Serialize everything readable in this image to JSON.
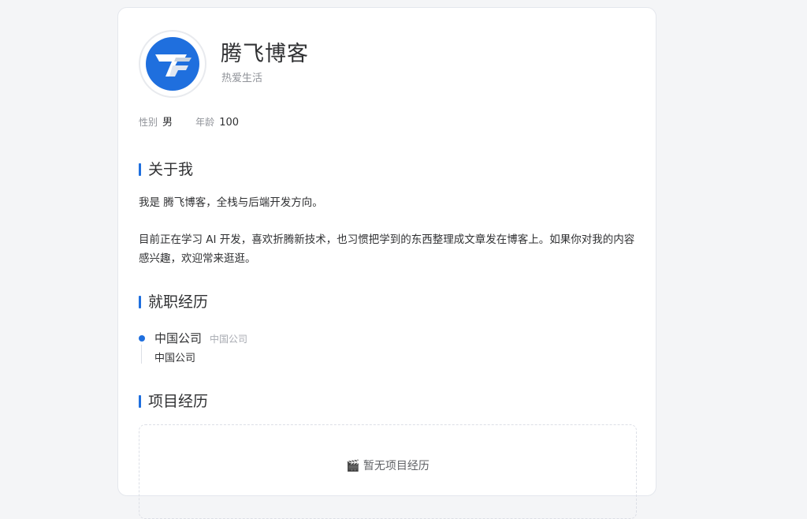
{
  "profile": {
    "name": "腾飞博客",
    "motto": "热爱生活",
    "avatar_icon": "tf-logo-icon",
    "brand_color": "#1f6fde"
  },
  "info": {
    "gender_label": "性别",
    "gender_value": "男",
    "age_label": "年龄",
    "age_value": "100"
  },
  "about": {
    "title": "关于我",
    "line1": "我是 腾飞博客，全栈与后端开发方向。",
    "line2": "目前正在学习 AI 开发，喜欢折腾新技术，也习惯把学到的东西整理成文章发在博客上。如果你对我的内容感兴趣，欢迎常来逛逛。"
  },
  "career": {
    "title": "就职经历",
    "items": [
      {
        "company": "中国公司",
        "subtitle": "中国公司",
        "description": "中国公司"
      }
    ]
  },
  "projects": {
    "title": "项目经历",
    "empty_icon": "clapper-icon",
    "empty_text": "🎬 暂无项目经历"
  }
}
